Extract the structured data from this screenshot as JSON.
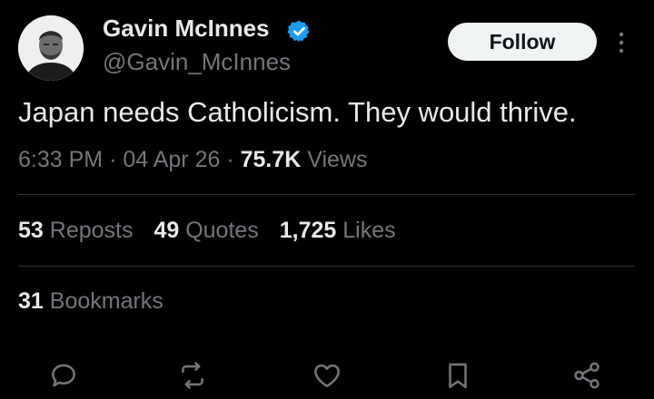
{
  "author": {
    "display_name": "Gavin McInnes",
    "handle": "@Gavin_McInnes",
    "verified": true
  },
  "header": {
    "follow_label": "Follow",
    "more_icon": "more-vertical-icon"
  },
  "tweet": {
    "text": "Japan needs Catholicism. They would thrive.",
    "time": "6:33 PM",
    "date": "04 Apr 26",
    "views_count": "75.7K",
    "views_label": "Views",
    "separator": "·"
  },
  "stats": {
    "reposts_count": "53",
    "reposts_label": "Reposts",
    "quotes_count": "49",
    "quotes_label": "Quotes",
    "likes_count": "1,725",
    "likes_label": "Likes",
    "bookmarks_count": "31",
    "bookmarks_label": "Bookmarks"
  },
  "actions": [
    "reply-icon",
    "repost-icon",
    "like-icon",
    "bookmark-icon",
    "share-icon"
  ],
  "colors": {
    "background": "#000000",
    "primary_text": "#e7e9ea",
    "secondary_text": "#71767b",
    "verified_blue": "#1d9bf0",
    "divider": "#2f3336",
    "follow_bg": "#eff3f4"
  }
}
